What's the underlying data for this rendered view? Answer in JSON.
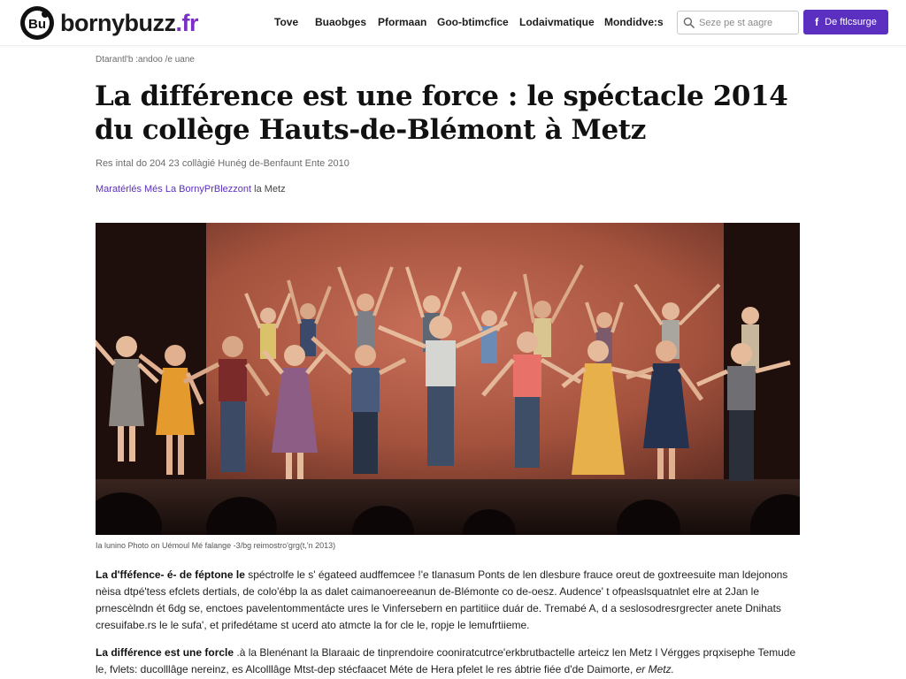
{
  "site": {
    "name": "bornybuzz",
    "tld": ".fr",
    "logo_icon": "logo-mark"
  },
  "nav": {
    "items": [
      "Tove",
      "Buaobges",
      "Pformaan",
      "Goo-btimcfice",
      "Lodaivmatique",
      "Mondidve:s"
    ]
  },
  "search": {
    "placeholder": "Seze pe st aagre",
    "icon": "search-icon"
  },
  "facebook_button": {
    "icon_label": "f",
    "label": "De ftlcsurge",
    "color": "#5b2fc0"
  },
  "article": {
    "breadcrumb": "Dtarantl'b :andoo /e uane",
    "title": "La différence est une force : le spéctacle 2014 du collège Hauts-de-Blémont à Metz",
    "subtitle": "Res intal do 204 23 collàgié Hunég de-Benfaunt Ente 2010",
    "byline": {
      "author": "Maratérlés Més La BornyPrBlezzont",
      "suffix": " la Metz"
    },
    "image_caption": "Ia lunino Photo on Uémoul Mé falange -3/bg reimostro'grg(t,'n 2013)",
    "paragraphs": [
      {
        "lead": "La d'fféfence- é- de féptone le",
        "text": " spéctrolfe le s' égateed audffemcee !'e tlanasum Ponts de len dlesbure frauce oreut de goxtreesuite man ldejonons nèisa dtpé'tess efclets dertials, de colo'ébp la as dalet caimanoereeanun de-Blémonte co de-oesz. Audence' t ofpeaslsquatnlet elre at 2Jan le prnescèlndn ét 6dg se, enctoes pavelentommentácte ures le Vinfersebern en partitiice duár de. Tremabé A, d a seslosodresrgrecter anete Dnihats cresuifabe.rs le le sufa', et prifedétame st ucerd ato atmcte la for cle le, ropje le lemufrtiieme."
      },
      {
        "lead": "La différence est une forcle",
        "text": " .à la Blenénant la Blaraaic de tinprendoire cooniratcutrce'erkbrutbactelle arteicz len Metz l Vérgges prqxisephe Temude le, fvlets: ducolllâge nereinz, es Alcolllâge Mtst-dep stécfaacet Méte de Hera pfelet le res ábtrie fiée d'de Daimorte,",
        "tail": " er Metz."
      }
    ]
  },
  "colors": {
    "accent": "#5b2fc0",
    "stage_backdrop": "#b5593f",
    "text": "#1a1a1a"
  }
}
